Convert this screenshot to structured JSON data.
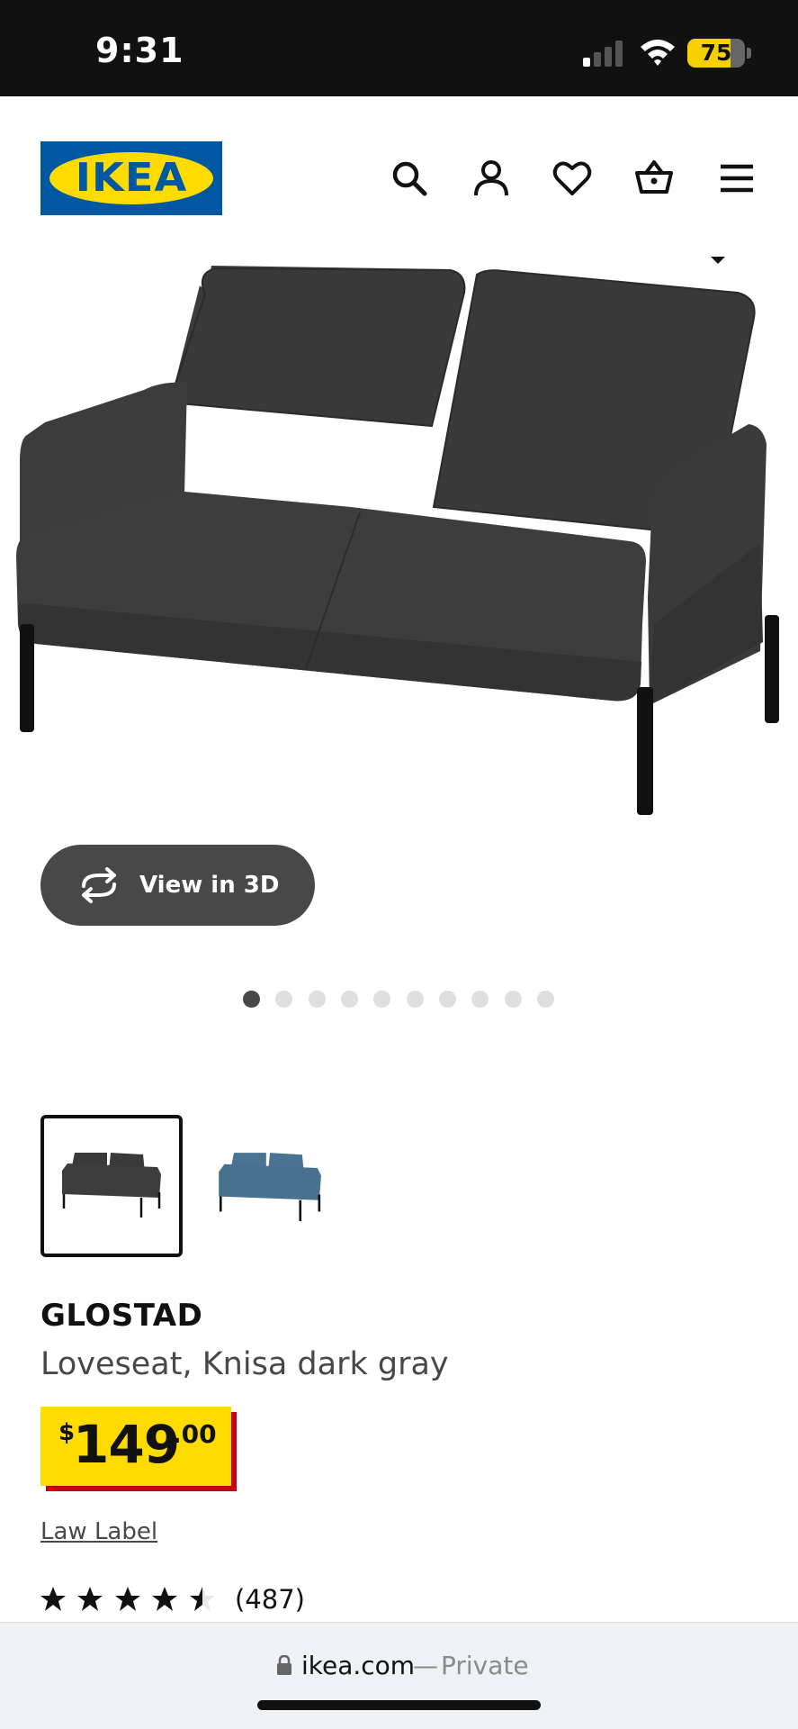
{
  "status_bar": {
    "time": "9:31",
    "battery_level": 75,
    "battery_label": "75",
    "signal_bars_active": 1,
    "signal_bars_total": 4
  },
  "header": {
    "logo_text": "IKEA",
    "logo_registered": "®",
    "icons": [
      "search-icon",
      "account-icon",
      "heart-icon",
      "basket-icon",
      "menu-icon"
    ]
  },
  "gallery": {
    "view_3d_label": "View in 3D",
    "image_count": 10,
    "active_index": 0
  },
  "variants": [
    {
      "name": "Knisa dark gray",
      "color": "#3a3a3a",
      "selected": true
    },
    {
      "name": "Knisa blue",
      "color": "#48708f",
      "selected": false
    }
  ],
  "product": {
    "name": "GLOSTAD",
    "description": "Loveseat, Knisa dark gray",
    "price_currency": "$",
    "price_whole": "149",
    "price_cents": ".00",
    "law_label": "Law Label",
    "rating": 4.5,
    "review_count": "(487)"
  },
  "browser": {
    "domain": "ikea.com",
    "separator": "—",
    "mode": "Private"
  },
  "colors": {
    "ikea_blue": "#0058a3",
    "ikea_yellow": "#ffdb00",
    "price_shadow_red": "#cc0008"
  }
}
